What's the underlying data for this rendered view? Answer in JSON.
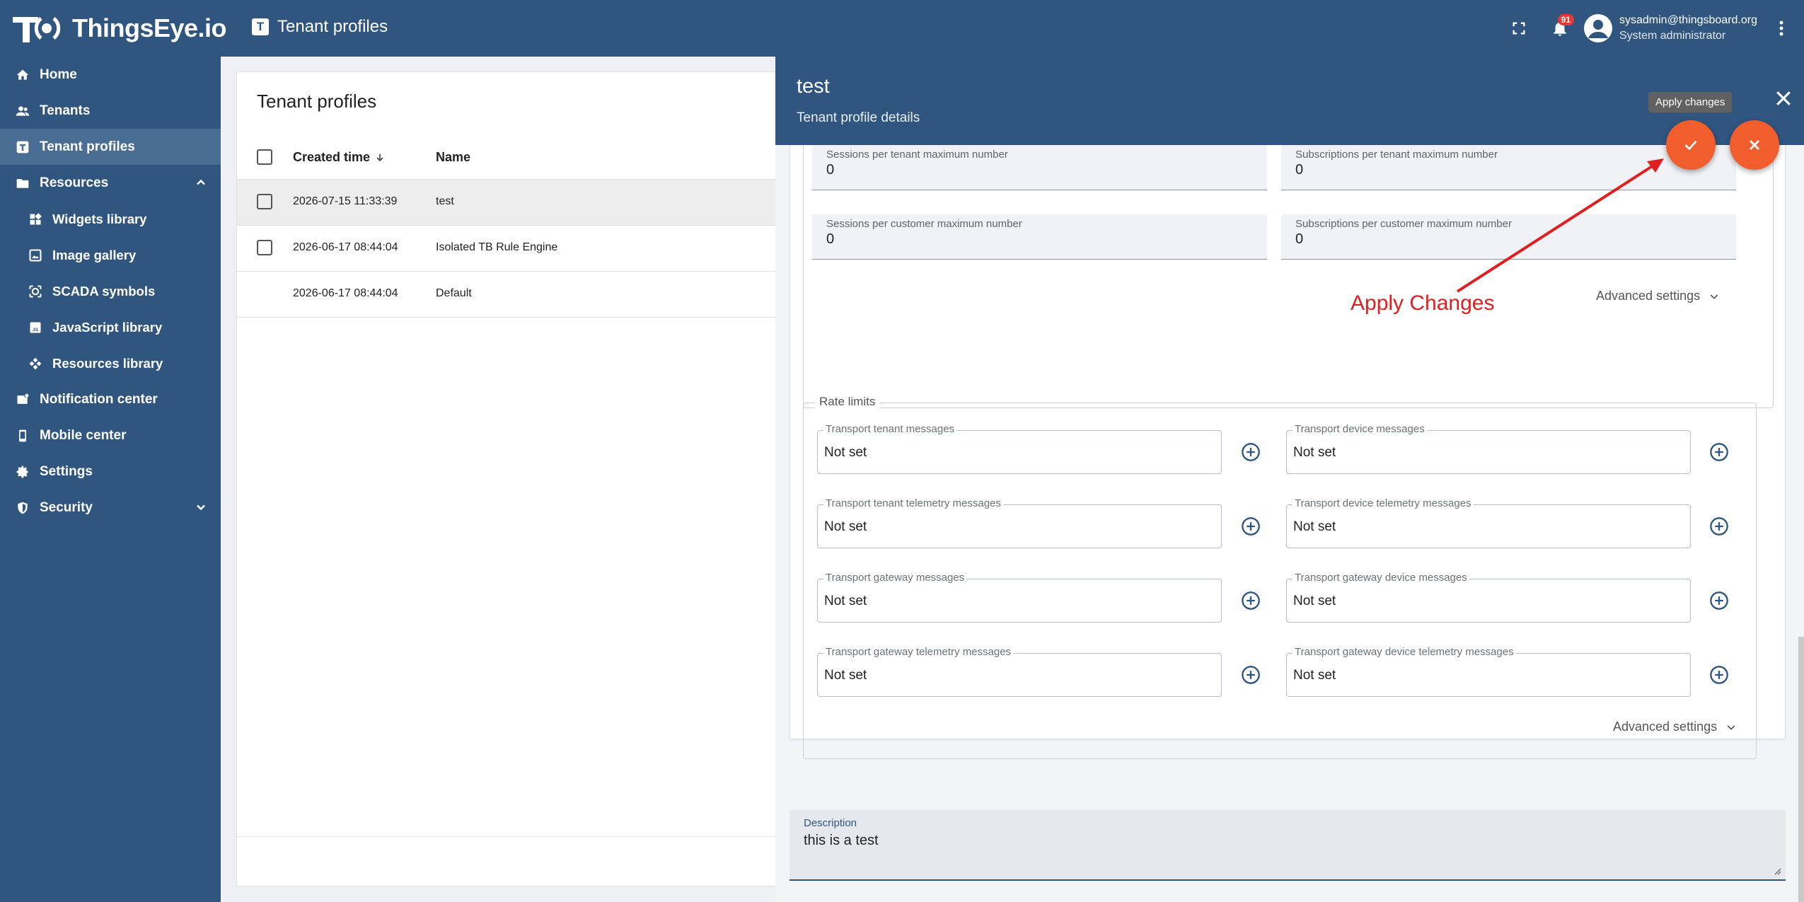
{
  "app": {
    "brand": "ThingsEye.io",
    "page_title": "Tenant profiles",
    "page_icon_letter": "T",
    "notification_count": "91",
    "user_email": "sysadmin@thingsboard.org",
    "user_role": "System administrator"
  },
  "sidebar": {
    "items": [
      {
        "label": "Home",
        "icon": "home-icon"
      },
      {
        "label": "Tenants",
        "icon": "people-icon"
      },
      {
        "label": "Tenant profiles",
        "icon": "tenant-profile-icon"
      },
      {
        "label": "Resources",
        "icon": "folder-icon"
      },
      {
        "label": "Widgets library",
        "icon": "widgets-icon"
      },
      {
        "label": "Image gallery",
        "icon": "image-icon"
      },
      {
        "label": "SCADA symbols",
        "icon": "scada-icon"
      },
      {
        "label": "JavaScript library",
        "icon": "javascript-icon"
      },
      {
        "label": "Resources library",
        "icon": "resources-icon"
      },
      {
        "label": "Notification center",
        "icon": "notification-icon"
      },
      {
        "label": "Mobile center",
        "icon": "mobile-icon"
      },
      {
        "label": "Settings",
        "icon": "gear-icon"
      },
      {
        "label": "Security",
        "icon": "shield-icon"
      }
    ]
  },
  "list": {
    "title": "Tenant profiles",
    "col_created": "Created time",
    "col_name": "Name",
    "rows": [
      {
        "created": "2026-07-15 11:33:39",
        "name": "test"
      },
      {
        "created": "2026-06-17 08:44:04",
        "name": "Isolated TB Rule Engine"
      },
      {
        "created": "2026-06-17 08:44:04",
        "name": "Default"
      }
    ]
  },
  "detail": {
    "title": "test",
    "subtitle": "Tenant profile details",
    "tooltip": "Apply changes",
    "sessions": [
      {
        "label": "Sessions per tenant maximum number",
        "value": "0"
      },
      {
        "label": "Subscriptions per tenant maximum number",
        "value": "0"
      },
      {
        "label": "Sessions per customer maximum number",
        "value": "0"
      },
      {
        "label": "Subscriptions per customer maximum number",
        "value": "0"
      }
    ],
    "advanced_settings": "Advanced settings",
    "rate_limits_legend": "Rate limits",
    "rate_limits": [
      {
        "label": "Transport tenant messages",
        "value": "Not set"
      },
      {
        "label": "Transport device messages",
        "value": "Not set"
      },
      {
        "label": "Transport tenant telemetry messages",
        "value": "Not set"
      },
      {
        "label": "Transport device telemetry messages",
        "value": "Not set"
      },
      {
        "label": "Transport gateway messages",
        "value": "Not set"
      },
      {
        "label": "Transport gateway device messages",
        "value": "Not set"
      },
      {
        "label": "Transport gateway telemetry messages",
        "value": "Not set"
      },
      {
        "label": "Transport gateway device telemetry messages",
        "value": "Not set"
      }
    ],
    "description_label": "Description",
    "description_value": "this is a test"
  },
  "annotation": {
    "text": "Apply Changes",
    "color": "#e02020"
  },
  "colors": {
    "primary": "#305680",
    "accent": "#f25d2d"
  }
}
